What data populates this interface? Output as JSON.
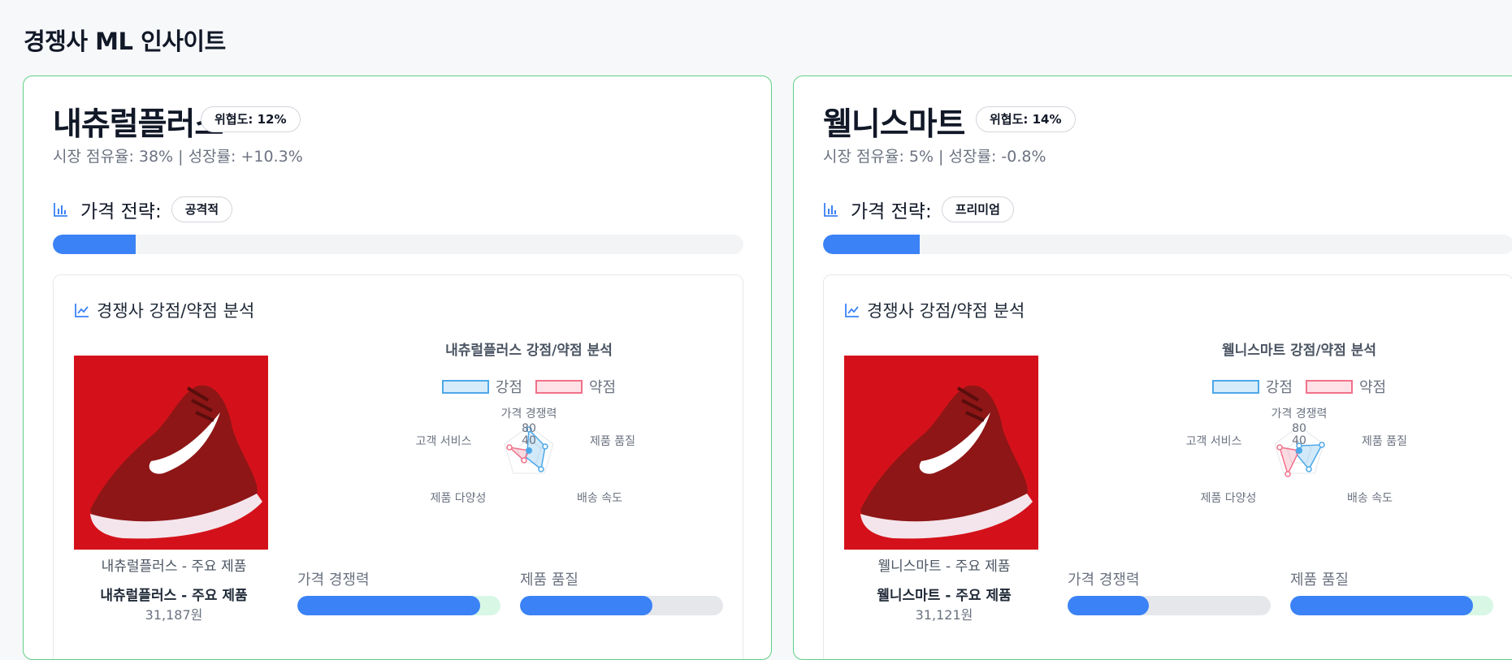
{
  "page": {
    "title": "경쟁사 ML 인사이트"
  },
  "legend": {
    "strong": "강점",
    "weak": "약점"
  },
  "axes": [
    "가격 경쟁력",
    "제품 품질",
    "배송 속도",
    "제품 다양성",
    "고객 서비스"
  ],
  "ticks": [
    "80",
    "40"
  ],
  "section_title": "경쟁사 강점/약점 분석",
  "strategy_label": "가격 전략:",
  "competitors": [
    {
      "name": "내츄럴플러스",
      "threat": "위협도: 12%",
      "stats": "시장 점유율: 38% | 성장률: +10.3%",
      "strategy": "공격적",
      "strategy_fill": 0.12,
      "radar_title": "내츄럴플러스 강점/약점 분석",
      "image_caption": "내츄럴플러스 - 주요 제품",
      "product_name": "내츄럴플러스 - 주요 제품",
      "price": "31,187원",
      "metrics": [
        {
          "label": "가격 경쟁력",
          "value": 0.9
        },
        {
          "label": "제품 품질",
          "value": 0.65
        }
      ],
      "colors": {
        "accent": "#3b82f6",
        "card_border": "#5fcf86"
      }
    },
    {
      "name": "웰니스마트",
      "threat": "위협도: 14%",
      "stats": "시장 점유율: 5% | 성장률: -0.8%",
      "strategy": "프리미엄",
      "strategy_fill": 0.14,
      "radar_title": "웰니스마트 강점/약점 분석",
      "image_caption": "웰니스마트 - 주요 제품",
      "product_name": "웰니스마트 - 주요 제품",
      "price": "31,121원",
      "metrics": [
        {
          "label": "가격 경쟁력",
          "value": 0.4
        },
        {
          "label": "제품 품질",
          "value": 0.9
        }
      ],
      "colors": {
        "accent": "#3b82f6",
        "card_border": "#5fcf86"
      }
    }
  ]
}
